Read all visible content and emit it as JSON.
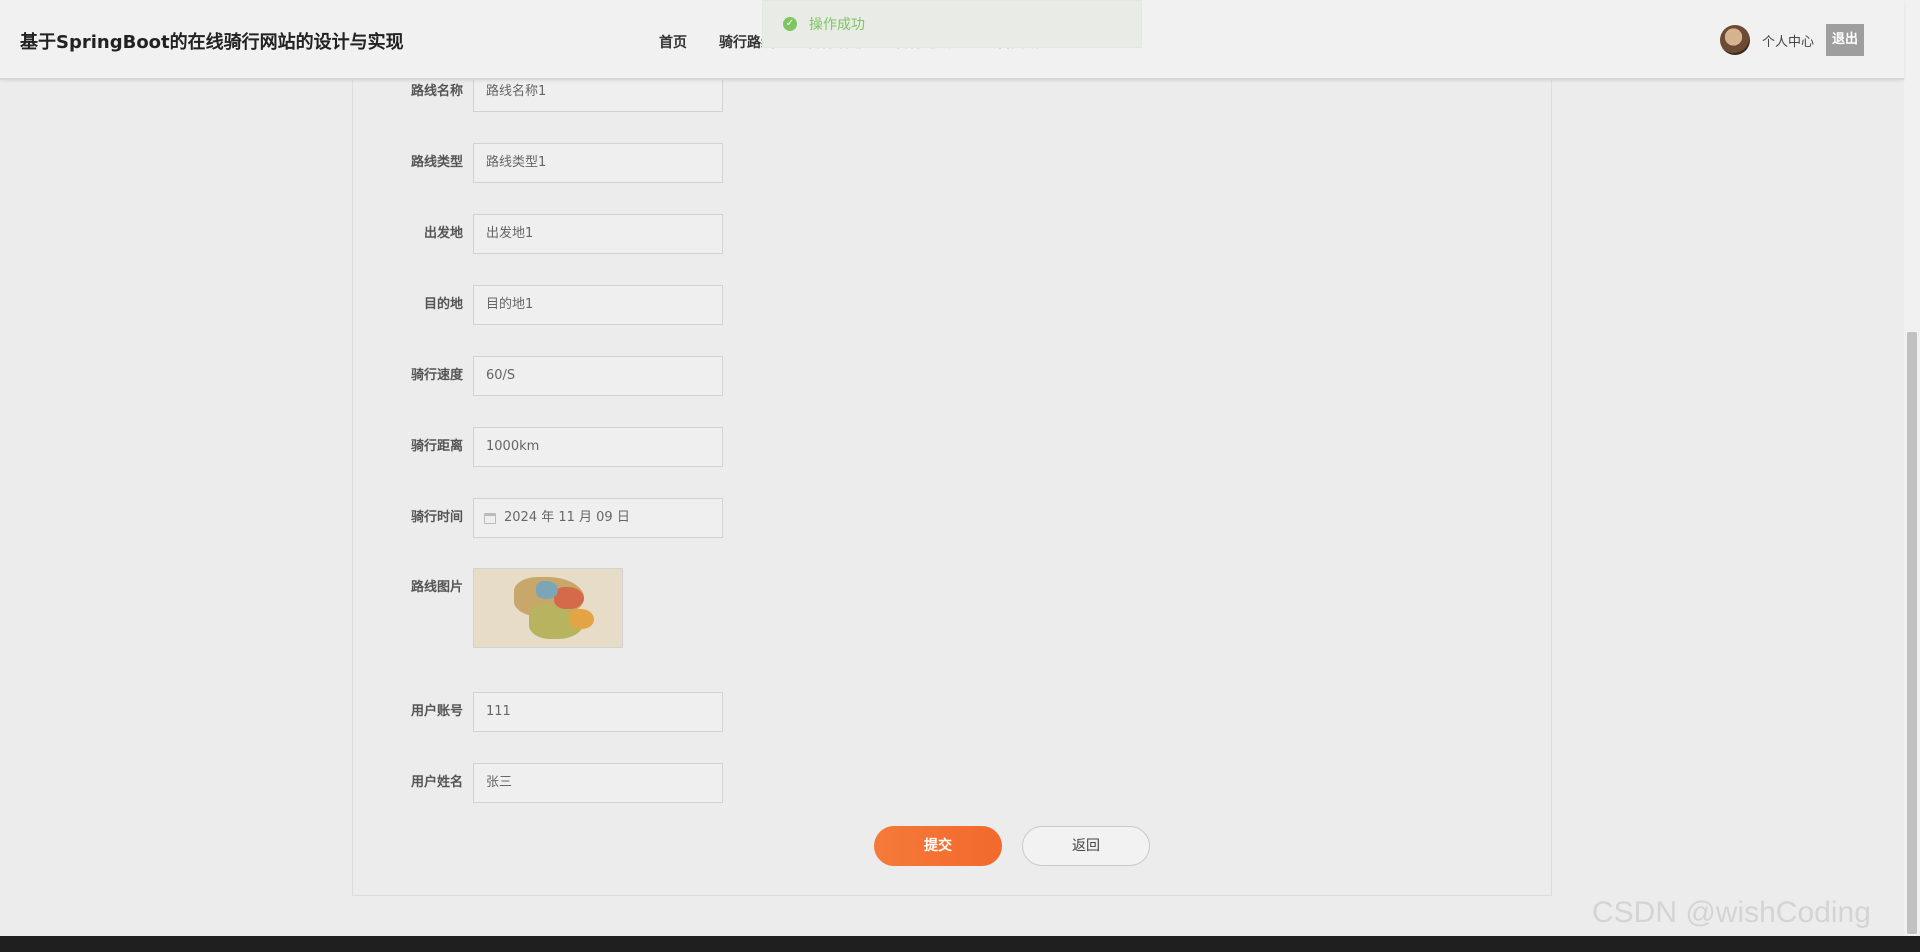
{
  "header": {
    "site_title": "基于SpringBoot的在线骑行网站的设计与实现",
    "nav": [
      "首页",
      "骑行路线",
      "骑行活动",
      "骑行论坛",
      "公告资讯"
    ],
    "personal_center": "个人中心",
    "logout": "退出"
  },
  "toast": {
    "text": "操作成功",
    "icon": "check-circle-icon",
    "color": "#7fc562"
  },
  "form": {
    "route_name": {
      "label": "路线名称",
      "value": "路线名称1"
    },
    "route_type": {
      "label": "路线类型",
      "value": "路线类型1"
    },
    "departure": {
      "label": "出发地",
      "value": "出发地1"
    },
    "destination": {
      "label": "目的地",
      "value": "目的地1"
    },
    "speed": {
      "label": "骑行速度",
      "value": "60/S"
    },
    "distance": {
      "label": "骑行距离",
      "value": "1000km"
    },
    "time": {
      "label": "骑行时间",
      "value": "2024 年 11 月 09 日"
    },
    "image": {
      "label": "路线图片"
    },
    "user_account": {
      "label": "用户账号",
      "value": "111"
    },
    "user_name": {
      "label": "用户姓名",
      "value": "张三"
    }
  },
  "buttons": {
    "submit": "提交",
    "back": "返回"
  },
  "colors": {
    "accent": "#f2692c",
    "success": "#7fc562"
  },
  "watermark": "CSDN @wishCoding"
}
